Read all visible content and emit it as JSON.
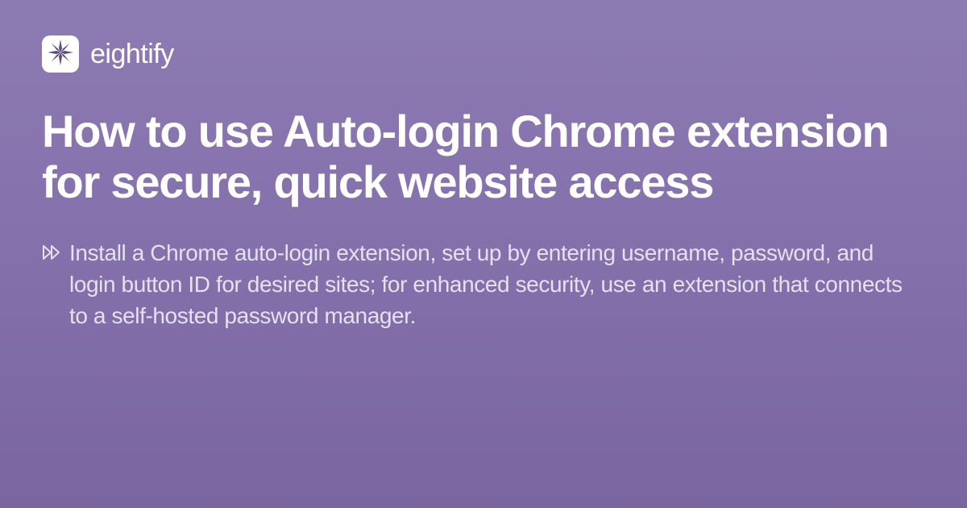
{
  "brand": {
    "name": "eightify"
  },
  "title": "How to use Auto-login Chrome extension for secure, quick website access",
  "summary": "Install a Chrome auto-login extension, set up by entering username, password, and login button ID for desired sites; for enhanced security, use an extension that connects to a self-hosted password manager.",
  "colors": {
    "bg_top": "#8d7bb3",
    "bg_bottom": "#7a65a1",
    "text_primary": "#ffffff",
    "text_secondary": "#e6e0f0",
    "logo_star": "#5a4a7a"
  }
}
